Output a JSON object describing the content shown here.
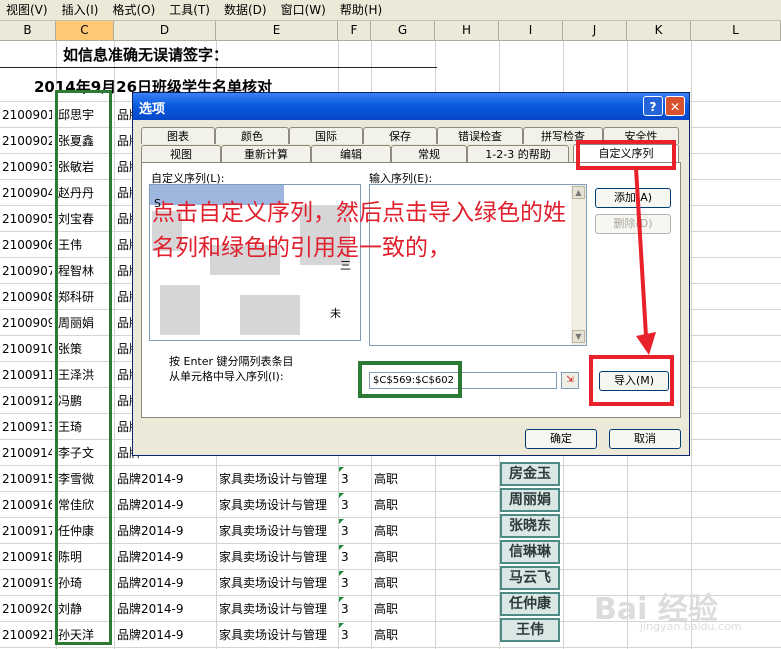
{
  "menu": [
    "视图(V)",
    "插入(I)",
    "格式(O)",
    "工具(T)",
    "数据(D)",
    "窗口(W)",
    "帮助(H)"
  ],
  "columns": [
    "B",
    "C",
    "D",
    "E",
    "F",
    "G",
    "H",
    "I",
    "J",
    "K",
    "L"
  ],
  "sheet": {
    "title1": "如信息准确无误请签字：",
    "title2": "2014年9月26日班级学生名单核对",
    "rows": [
      {
        "id": "2100901",
        "name": "邱思宇",
        "cls": "品牌",
        "major": "",
        "year": "",
        "level": ""
      },
      {
        "id": "2100902",
        "name": "张夏鑫",
        "cls": "品牌",
        "major": "",
        "year": "",
        "level": ""
      },
      {
        "id": "2100903",
        "name": "张敏岩",
        "cls": "品牌",
        "major": "",
        "year": "",
        "level": ""
      },
      {
        "id": "2100904",
        "name": "赵丹丹",
        "cls": "品牌",
        "major": "",
        "year": "",
        "level": ""
      },
      {
        "id": "2100905",
        "name": "刘宝春",
        "cls": "品牌",
        "major": "",
        "year": "",
        "level": ""
      },
      {
        "id": "2100906",
        "name": "王伟",
        "cls": "品牌",
        "major": "",
        "year": "",
        "level": ""
      },
      {
        "id": "2100907",
        "name": "程智林",
        "cls": "品牌",
        "major": "",
        "year": "",
        "level": ""
      },
      {
        "id": "2100908",
        "name": "郑科研",
        "cls": "品牌",
        "major": "",
        "year": "",
        "level": ""
      },
      {
        "id": "2100909",
        "name": "周丽娟",
        "cls": "品牌",
        "major": "",
        "year": "",
        "level": ""
      },
      {
        "id": "2100910",
        "name": "张策",
        "cls": "品牌",
        "major": "",
        "year": "",
        "level": ""
      },
      {
        "id": "2100911",
        "name": "王泽洪",
        "cls": "品牌",
        "major": "",
        "year": "",
        "level": ""
      },
      {
        "id": "2100912",
        "name": "冯鹏",
        "cls": "品牌",
        "major": "",
        "year": "",
        "level": ""
      },
      {
        "id": "2100913",
        "name": "王琦",
        "cls": "品牌",
        "major": "",
        "year": "",
        "level": ""
      },
      {
        "id": "2100914",
        "name": "李子文",
        "cls": "品牌",
        "major": "",
        "year": "",
        "level": ""
      },
      {
        "id": "2100915",
        "name": "李雪微",
        "cls": "品牌2014-9",
        "major": "家具卖场设计与管理",
        "year": "3",
        "level": "高职"
      },
      {
        "id": "2100916",
        "name": "常佳欣",
        "cls": "品牌2014-9",
        "major": "家具卖场设计与管理",
        "year": "3",
        "level": "高职"
      },
      {
        "id": "2100917",
        "name": "任仲康",
        "cls": "品牌2014-9",
        "major": "家具卖场设计与管理",
        "year": "3",
        "level": "高职"
      },
      {
        "id": "2100918",
        "name": "陈明",
        "cls": "品牌2014-9",
        "major": "家具卖场设计与管理",
        "year": "3",
        "level": "高职"
      },
      {
        "id": "2100919",
        "name": "孙琦",
        "cls": "品牌2014-9",
        "major": "家具卖场设计与管理",
        "year": "3",
        "level": "高职"
      },
      {
        "id": "2100920",
        "name": "刘静",
        "cls": "品牌2014-9",
        "major": "家具卖场设计与管理",
        "year": "3",
        "level": "高职"
      },
      {
        "id": "2100921",
        "name": "孙天洋",
        "cls": "品牌2014-9",
        "major": "家具卖场设计与管理",
        "year": "3",
        "level": "高职"
      }
    ],
    "name_cards": [
      "房金玉",
      "周丽娟",
      "张晓东",
      "信琳琳",
      "马云飞",
      "任仲康",
      "王伟"
    ]
  },
  "dialog": {
    "title": "选项",
    "tabs_row1": [
      "图表",
      "颜色",
      "国际",
      "保存",
      "错误检查",
      "拼写检查",
      "安全性"
    ],
    "tabs_row2": [
      "视图",
      "重新计算",
      "编辑",
      "常规",
      "1-2-3 的帮助",
      "自定义序列"
    ],
    "custom_list_label": "自定义序列(L):",
    "input_list_label": "输入序列(E):",
    "add_button": "添加(A)",
    "delete_button": "删除(D)",
    "hint_line1": "按 Enter 键分隔列表条目",
    "hint_line2": "从单元格中导入序列(I):",
    "range_value": "$C$569:$C$602",
    "import_button": "导入(M)",
    "ok_button": "确定",
    "cancel_button": "取消",
    "list_fragments": [
      "S",
      "三",
      "未"
    ]
  },
  "annotation": "点击自定义序列，然后点击导入绿色的姓名列和绿色的引用是一致的，",
  "watermark": "Bai 经验",
  "watermark_url": "jingyan.baidu.com",
  "colors": {
    "highlight_red": "#e8212b",
    "highlight_green": "#2c7a33",
    "title_blue": "#0a5be0"
  }
}
